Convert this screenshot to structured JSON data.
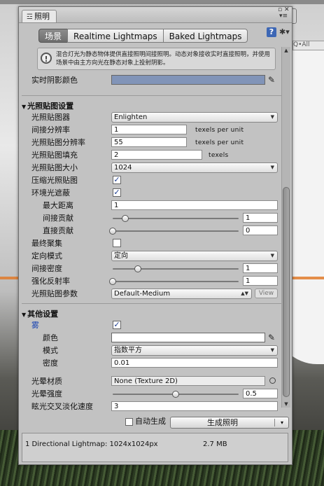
{
  "window": {
    "tab_icon": "☲",
    "tab_title": "照明",
    "controls": "▫ ✕\n▾≡"
  },
  "modes": [
    {
      "label": "场景",
      "selected": true
    },
    {
      "label": "Realtime Lightmaps",
      "selected": false
    },
    {
      "label": "Baked Lightmaps",
      "selected": false
    }
  ],
  "toolbar": {
    "book_icon": "?",
    "gear_icon": "✱▾"
  },
  "background": {
    "search_placeholder": "Q•All"
  },
  "help_text": "混合灯光为静态物体提供直接照明间接照明。动态对象接收实时直接照明，并使用场景中由主方向光在静态对象上投射阴影。",
  "realtime_shadow_color": {
    "label": "实时阴影颜色",
    "color": "#8194b8"
  },
  "lightmap_section": {
    "title": "光照贴图设置",
    "lightmapper": {
      "label": "光照贴图器",
      "value": "Enlighten"
    },
    "indirect_resolution": {
      "label": "间接分辨率",
      "value": "1",
      "unit": "texels per unit"
    },
    "lightmap_resolution": {
      "label": "光照贴图分辨率",
      "value": "55",
      "unit": "texels per unit"
    },
    "lightmap_padding": {
      "label": "光照贴图填充",
      "value": "2",
      "unit": "texels"
    },
    "lightmap_size": {
      "label": "光照贴图大小",
      "value": "1024"
    },
    "compress": {
      "label": "压缩光照贴图",
      "checked": true
    },
    "ao": {
      "label": "环境光遮蔽",
      "checked": true
    },
    "max_distance": {
      "label": "最大距离",
      "value": "1"
    },
    "indirect_contribution": {
      "label": "间接贡献",
      "value": "1",
      "fraction": 0.1
    },
    "direct_contribution": {
      "label": "直接贡献",
      "value": "0",
      "fraction": 0.0
    },
    "final_gather": {
      "label": "最终聚集",
      "checked": false
    },
    "directional_mode": {
      "label": "定向模式",
      "value": "定向"
    },
    "indirect_intensity": {
      "label": "间接密度",
      "value": "1",
      "fraction": 0.2
    },
    "albedo_boost": {
      "label": "强化反射率",
      "value": "1",
      "fraction": 0.0
    },
    "lightmap_parameters": {
      "label": "光照贴图参数",
      "value": "Default-Medium",
      "button": "View"
    }
  },
  "other_section": {
    "title": "其他设置",
    "fog": {
      "label": "雾",
      "checked": true
    },
    "fog_color": {
      "label": "颜色",
      "color": "#ffffff"
    },
    "fog_mode": {
      "label": "模式",
      "value": "指数平方"
    },
    "fog_density": {
      "label": "密度",
      "value": "0.01"
    },
    "halo_texture": {
      "label": "光晕材质",
      "value": "None (Texture 2D)"
    },
    "halo_strength": {
      "label": "光晕强度",
      "value": "0.5",
      "fraction": 0.5
    },
    "flare_fade": {
      "label": "眩光交叉淡化速度",
      "value": "3"
    }
  },
  "bottom": {
    "auto_label": "自动生成",
    "auto_checked": false,
    "build_label": "生成照明",
    "build_drop": "▾"
  },
  "status": {
    "lightmaps": "1 Directional Lightmap: 1024x1024px",
    "size": "2.7 MB"
  }
}
